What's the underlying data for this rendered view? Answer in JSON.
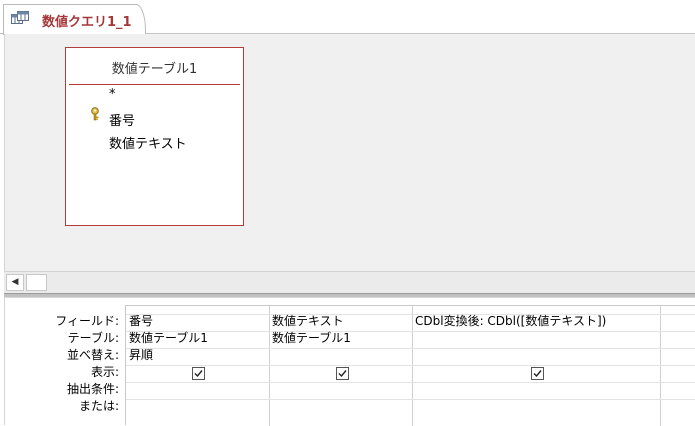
{
  "tab": {
    "title": "数値クエリ1_1",
    "icon": "query-icon"
  },
  "table_box": {
    "title": "数値テーブル1",
    "fields": [
      {
        "label": "*"
      },
      {
        "label": "番号",
        "is_key": true,
        "icon": "key-icon"
      },
      {
        "label": "数値テキスト"
      }
    ]
  },
  "scrollbar": {
    "left_arrow": "◀"
  },
  "qbe": {
    "row_labels": {
      "field": "フィールド:",
      "table": "テーブル:",
      "sort": "並べ替え:",
      "show": "表示:",
      "criteria": "抽出条件:",
      "or": "または:"
    },
    "columns": [
      {
        "field": "番号",
        "table": "数値テーブル1",
        "sort": "昇順",
        "show": true
      },
      {
        "field": "数値テキスト",
        "table": "数値テーブル1",
        "sort": "",
        "show": true
      },
      {
        "field": "CDbl変換後: CDbl([数値テキスト])",
        "table": "",
        "sort": "",
        "show": true
      }
    ]
  }
}
